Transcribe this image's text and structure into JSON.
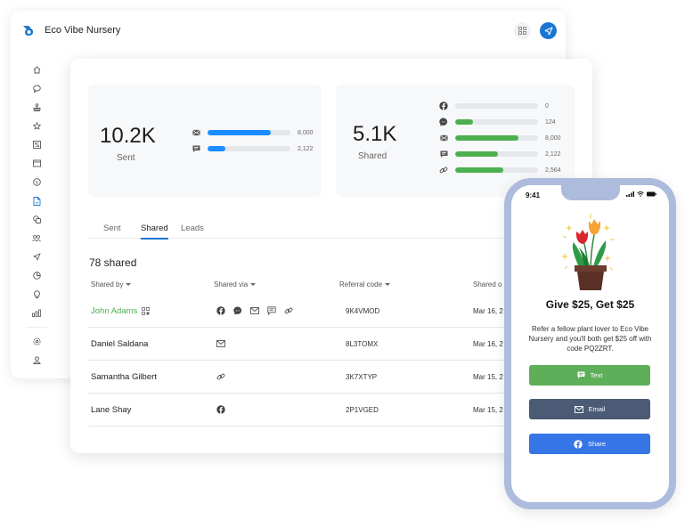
{
  "app": {
    "name": "Eco Vibe Nursery",
    "accent": "#1976d2"
  },
  "top_actions": [
    {
      "icon": "grid-icon"
    },
    {
      "icon": "send-icon"
    }
  ],
  "sidebar": {
    "items": [
      {
        "icon": "home-icon",
        "active": false
      },
      {
        "icon": "chat-icon",
        "active": false
      },
      {
        "icon": "stamp-icon",
        "active": false
      },
      {
        "icon": "star-icon",
        "active": false
      },
      {
        "icon": "grid-box-icon",
        "active": false
      },
      {
        "icon": "window-icon",
        "active": false
      },
      {
        "icon": "dollar-coin-icon",
        "active": false
      },
      {
        "icon": "document-icon",
        "active": true
      },
      {
        "icon": "copy-icon",
        "active": false
      },
      {
        "icon": "users-icon",
        "active": false
      },
      {
        "icon": "send-icon",
        "active": false
      },
      {
        "icon": "pie-chart-icon",
        "active": false
      },
      {
        "icon": "lightbulb-icon",
        "active": false
      },
      {
        "icon": "bar-chart-icon",
        "active": false
      }
    ],
    "bottom_items": [
      {
        "icon": "settings-icon"
      },
      {
        "icon": "user-icon"
      }
    ]
  },
  "stats": {
    "sent": {
      "value": "10.2K",
      "label": "Sent",
      "bar_color": "#1a8cff",
      "channels": [
        {
          "icon": "email-icon",
          "value": "8,000",
          "fraction": 0.76
        },
        {
          "icon": "sms-icon",
          "value": "2,122",
          "fraction": 0.22
        }
      ]
    },
    "shared": {
      "value": "5.1K",
      "label": "Shared",
      "bar_color": "#4caf50",
      "channels": [
        {
          "icon": "facebook-icon",
          "value": "0",
          "fraction": 0.0
        },
        {
          "icon": "messenger-icon",
          "value": "124",
          "fraction": 0.22
        },
        {
          "icon": "email-icon",
          "value": "8,000",
          "fraction": 0.76
        },
        {
          "icon": "sms-icon",
          "value": "2,122",
          "fraction": 0.52
        },
        {
          "icon": "link-icon",
          "value": "2,564",
          "fraction": 0.58
        }
      ]
    }
  },
  "tabs": [
    {
      "label": "Sent",
      "active": false
    },
    {
      "label": "Shared",
      "active": true
    },
    {
      "label": "Leads",
      "active": false
    }
  ],
  "table": {
    "count_label": "78 shared",
    "columns": [
      "Shared by",
      "Shared via",
      "Referral code",
      "Shared o"
    ],
    "rows": [
      {
        "name": "John Adams",
        "highlight": true,
        "qr": true,
        "via": [
          "facebook-icon",
          "messenger-icon",
          "email-icon",
          "sms-icon",
          "link-icon"
        ],
        "code": "9K4VMOD",
        "date": "Mar 16, 2"
      },
      {
        "name": "Daniel Saldana",
        "highlight": false,
        "qr": false,
        "via": [
          "email-icon"
        ],
        "code": "8L3TOMX",
        "date": "Mar 16, 2"
      },
      {
        "name": "Samantha Gilbert",
        "highlight": false,
        "qr": false,
        "via": [
          "link-icon"
        ],
        "code": "3K7XTYP",
        "date": "Mar 15, 2"
      },
      {
        "name": "Lane Shay",
        "highlight": false,
        "qr": false,
        "via": [
          "facebook-icon"
        ],
        "code": "2P1VGED",
        "date": "Mar 15, 2"
      }
    ]
  },
  "phone": {
    "time": "9:41",
    "title": "Give $25, Get $25",
    "body": "Refer a fellow plant lover to Eco Vibe Nursery and you'll both get $25 off with code PQ2ZRT.",
    "buttons": [
      {
        "label": "Text",
        "icon": "sms-icon",
        "color": "#5fae5a"
      },
      {
        "label": "Email",
        "icon": "email-icon",
        "color": "#4b5a75"
      },
      {
        "label": "Share",
        "icon": "facebook-icon",
        "color": "#3575e6"
      }
    ]
  }
}
